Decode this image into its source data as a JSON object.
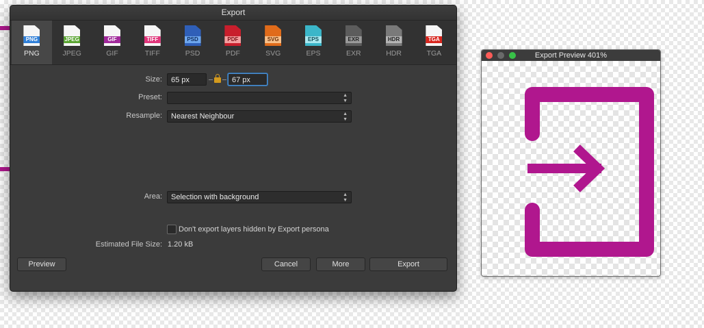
{
  "dialog": {
    "title": "Export",
    "formats": [
      {
        "name": "PNG",
        "badge": "PNG",
        "icon": "png-file-icon"
      },
      {
        "name": "JPEG",
        "badge": "JPEG",
        "icon": "jpeg-file-icon"
      },
      {
        "name": "GIF",
        "badge": "GIF",
        "icon": "gif-file-icon"
      },
      {
        "name": "TIFF",
        "badge": "TIFF",
        "icon": "tiff-file-icon"
      },
      {
        "name": "PSD",
        "badge": "PSD",
        "icon": "psd-file-icon"
      },
      {
        "name": "PDF",
        "badge": "PDF",
        "icon": "pdf-file-icon"
      },
      {
        "name": "SVG",
        "badge": "SVG",
        "icon": "svg-file-icon"
      },
      {
        "name": "EPS",
        "badge": "EPS",
        "icon": "eps-file-icon"
      },
      {
        "name": "EXR",
        "badge": "EXR",
        "icon": "exr-file-icon"
      },
      {
        "name": "HDR",
        "badge": "HDR",
        "icon": "hdr-file-icon"
      },
      {
        "name": "TGA",
        "badge": "TGA",
        "icon": "tga-file-icon"
      }
    ],
    "selected_format": "PNG",
    "size_label": "Size:",
    "width_value": "65 px",
    "height_value": "67 px",
    "preset_label": "Preset:",
    "preset_value": "",
    "resample_label": "Resample:",
    "resample_value": "Nearest Neighbour",
    "area_label": "Area:",
    "area_value": "Selection with background",
    "hidden_layers_label": "Don't export layers hidden by Export persona",
    "hidden_layers_checked": false,
    "filesize_label": "Estimated File Size:",
    "filesize_value": "1.20 kB",
    "buttons": {
      "preview": "Preview",
      "cancel": "Cancel",
      "more": "More",
      "export": "Export"
    }
  },
  "preview_window": {
    "title": "Export Preview 401%",
    "icon": "sign-in-icon",
    "icon_color": "#b0178e"
  },
  "colors": {
    "dialog_bg": "#3b3b3b",
    "accent": "#4f8fd0",
    "magenta": "#b0178e"
  }
}
